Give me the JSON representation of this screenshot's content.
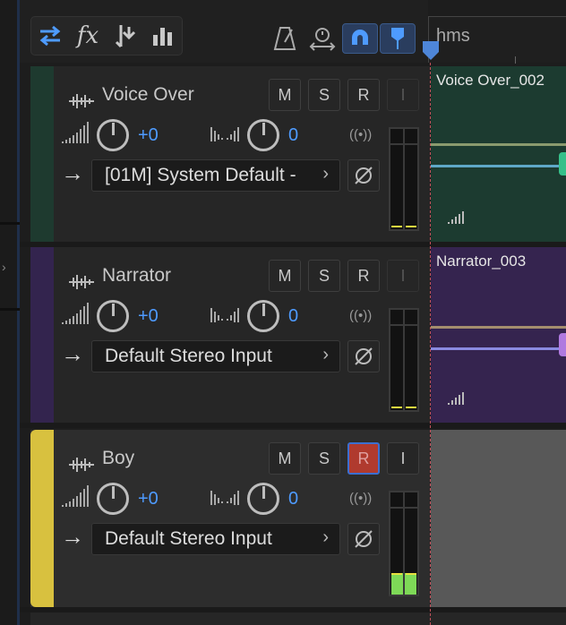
{
  "toolbar": {
    "buttons": [
      "toggle-swap",
      "fx",
      "merge",
      "levels"
    ],
    "right_buttons": [
      "metronome",
      "loop",
      "magnet",
      "marker"
    ]
  },
  "timeline": {
    "ruler_label": "hms"
  },
  "tracks": [
    {
      "name": "Voice Over",
      "color": "#1e3a2f",
      "buttons": {
        "m": "M",
        "s": "S",
        "r": "R",
        "i": "I"
      },
      "volume": "+0",
      "pan": "0",
      "input": "[01M] System Default -",
      "record_armed": false,
      "clip_name": "Voice Over_002",
      "clip_color": "#1c3b30",
      "meter_level": 0
    },
    {
      "name": "Narrator",
      "color": "#33244e",
      "buttons": {
        "m": "M",
        "s": "S",
        "r": "R",
        "i": "I"
      },
      "volume": "+0",
      "pan": "0",
      "input": "Default Stereo Input",
      "record_armed": false,
      "clip_name": "Narrator_003",
      "clip_color": "#35244f",
      "meter_level": 0
    },
    {
      "name": "Boy",
      "color": "#d8c13f",
      "buttons": {
        "m": "M",
        "s": "S",
        "r": "R",
        "i": "I"
      },
      "volume": "+0",
      "pan": "0",
      "input": "Default Stereo Input",
      "record_armed": true,
      "clip_name": "",
      "clip_color": "#585858",
      "meter_level": 0.5
    }
  ]
}
